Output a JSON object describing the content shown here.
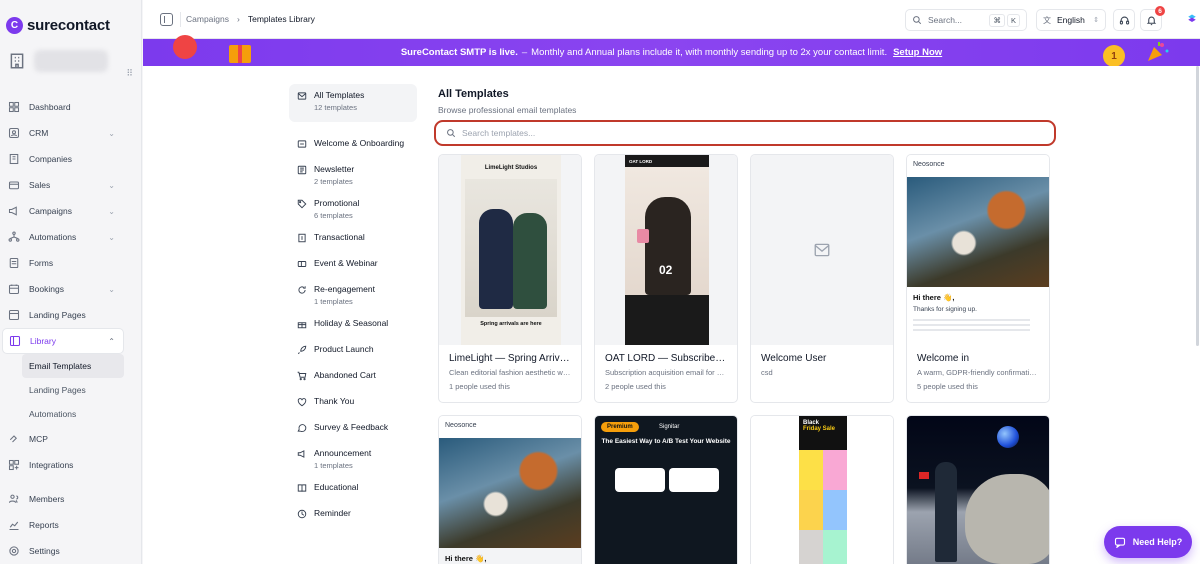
{
  "app": {
    "logo_text": "surecontact"
  },
  "sidebar": {
    "items": [
      {
        "label": "Dashboard",
        "icon": "dashboard-icon"
      },
      {
        "label": "CRM",
        "icon": "contacts-icon",
        "chevron": true
      },
      {
        "label": "Companies",
        "icon": "building-icon"
      },
      {
        "label": "Sales",
        "icon": "wallet-icon",
        "chevron": true
      },
      {
        "label": "Campaigns",
        "icon": "megaphone-icon",
        "chevron": true
      },
      {
        "label": "Automations",
        "icon": "workflow-icon",
        "chevron": true
      },
      {
        "label": "Forms",
        "icon": "form-icon"
      },
      {
        "label": "Bookings",
        "icon": "calendar-icon",
        "chevron": true
      },
      {
        "label": "Landing Pages",
        "icon": "page-icon"
      },
      {
        "label": "Library",
        "icon": "library-icon",
        "chevron": true,
        "active": true
      }
    ],
    "library_sub": [
      "Email Templates",
      "Landing Pages",
      "Automations"
    ],
    "bottom": [
      {
        "label": "MCP",
        "icon": "mcp-icon"
      },
      {
        "label": "Integrations",
        "icon": "integrations-icon"
      },
      {
        "label": "Members",
        "icon": "members-icon"
      },
      {
        "label": "Reports",
        "icon": "reports-icon"
      },
      {
        "label": "Settings",
        "icon": "settings-icon"
      }
    ]
  },
  "topbar": {
    "breadcrumb": [
      "Campaigns",
      "Templates Library"
    ],
    "search_placeholder": "Search...",
    "kbd": [
      "⌘",
      "K"
    ],
    "language": "English",
    "notification_count": "6"
  },
  "banner": {
    "bold": "SureContact SMTP is live.",
    "dash": "–",
    "text": "Monthly and Annual plans include it, with monthly sending up to 2x your contact limit.",
    "link": "Setup Now",
    "medal": "1"
  },
  "categories": [
    {
      "name": "All Templates",
      "count": "12 templates",
      "icon": "mail-icon",
      "active": true
    },
    {
      "name": "Welcome & Onboarding",
      "count": "",
      "icon": "welcome-icon"
    },
    {
      "name": "Newsletter",
      "count": "2 templates",
      "icon": "newspaper-icon"
    },
    {
      "name": "Promotional",
      "count": "6 templates",
      "icon": "tag-icon"
    },
    {
      "name": "Transactional",
      "count": "",
      "icon": "receipt-icon"
    },
    {
      "name": "Event & Webinar",
      "count": "",
      "icon": "ticket-icon"
    },
    {
      "name": "Re-engagement",
      "count": "1 templates",
      "icon": "refresh-icon"
    },
    {
      "name": "Holiday & Seasonal",
      "count": "",
      "icon": "gift-icon"
    },
    {
      "name": "Product Launch",
      "count": "",
      "icon": "rocket-icon"
    },
    {
      "name": "Abandoned Cart",
      "count": "",
      "icon": "cart-icon"
    },
    {
      "name": "Thank You",
      "count": "",
      "icon": "heart-icon"
    },
    {
      "name": "Survey & Feedback",
      "count": "",
      "icon": "chat-icon"
    },
    {
      "name": "Announcement",
      "count": "1 templates",
      "icon": "megaphone-icon"
    },
    {
      "name": "Educational",
      "count": "",
      "icon": "book-icon"
    },
    {
      "name": "Reminder",
      "count": "",
      "icon": "clock-icon"
    }
  ],
  "content": {
    "title": "All Templates",
    "subtitle": "Browse professional email templates",
    "search_placeholder": "Search templates..."
  },
  "templates": [
    {
      "title": "LimeLight — Spring Arrivals",
      "desc": "Clean editorial fashion aesthetic with ...",
      "used": "1 people used this",
      "thumb_brand": "LimeLight Studios",
      "thumb_caption": "Spring arrivals are here"
    },
    {
      "title": "OAT LORD — Subscribe & ...",
      "desc": "Subscription acquisition email for NU...",
      "used": "2 people used this",
      "thumb_brand": "OAT LORD",
      "thumb_num": "02"
    },
    {
      "title": "Welcome User",
      "desc": "csd",
      "used": ""
    },
    {
      "title": "Welcome in",
      "desc": "A warm, GDPR-friendly confirmation ...",
      "used": "5 people used this",
      "thumb_brand": "Neosonce",
      "thumb_hi": "Hi there 👋,",
      "thumb_thanks": "Thanks for signing up."
    },
    {
      "thumb_brand": "Neosonce",
      "thumb_hi": "Hi there 👋,"
    },
    {
      "thumb_badge": "Premium",
      "thumb_brand": "Signitar",
      "thumb_headline": "The Easiest Way to A/B Test Your Website"
    },
    {
      "thumb_brand": "Black",
      "thumb_sub": "Friday Sale"
    },
    {}
  ],
  "help_button": "Need Help?"
}
